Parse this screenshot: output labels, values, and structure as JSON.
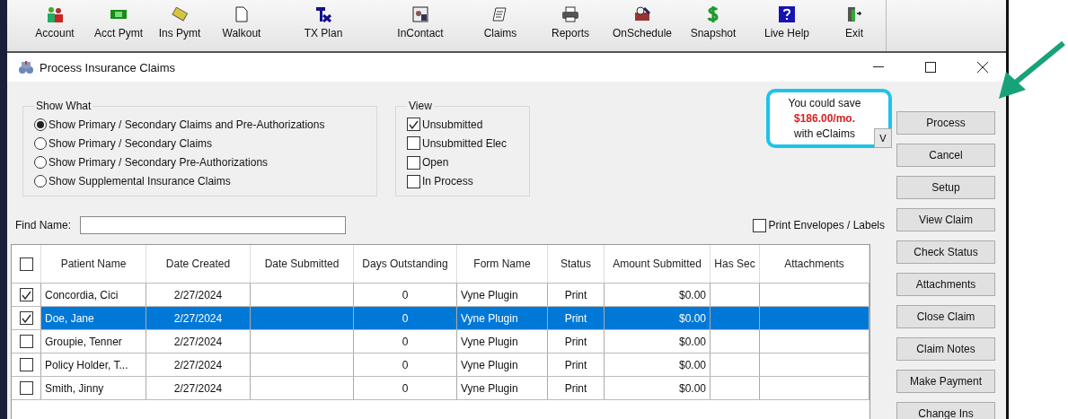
{
  "toolbar": [
    {
      "label": "Account"
    },
    {
      "label": "Acct Pymt"
    },
    {
      "label": "Ins Pymt"
    },
    {
      "label": "Walkout"
    },
    {
      "label": "TX Plan"
    },
    {
      "label": "InContact"
    },
    {
      "label": "Claims"
    },
    {
      "label": "Reports"
    },
    {
      "label": "OnSchedule"
    },
    {
      "label": "Snapshot"
    },
    {
      "label": "Live Help"
    },
    {
      "label": "Exit"
    }
  ],
  "window": {
    "title": "Process Insurance Claims"
  },
  "show_what": {
    "title": "Show What",
    "options": [
      {
        "label": "Show Primary / Secondary Claims and Pre-Authorizations",
        "selected": true
      },
      {
        "label": "Show Primary / Secondary Claims",
        "selected": false
      },
      {
        "label": "Show Primary / Secondary Pre-Authorizations",
        "selected": false
      },
      {
        "label": "Show Supplemental Insurance Claims",
        "selected": false
      }
    ]
  },
  "view": {
    "title": "View",
    "options": [
      {
        "label": "Unsubmitted",
        "checked": true
      },
      {
        "label": "Unsubmitted Elec",
        "checked": false
      },
      {
        "label": "Open",
        "checked": false
      },
      {
        "label": "In Process",
        "checked": false
      }
    ]
  },
  "promo": {
    "line_1": "You could save",
    "amount": "$186.00/mo.",
    "line_3": "with eClaims",
    "toggle": "V"
  },
  "find_name": {
    "label": "Find Name:"
  },
  "print_envelopes": {
    "label": "Print Envelopes / Labels",
    "checked": false
  },
  "table": {
    "header_checked": false,
    "columns": [
      "Patient Name",
      "Date Created",
      "Date Submitted",
      "Days Outstanding",
      "Form Name",
      "Status",
      "Amount Submitted",
      "Has Sec",
      "Attachments"
    ],
    "rows": [
      {
        "checked": true,
        "selected": false,
        "cells": [
          "Concordia, Cici",
          "2/27/2024",
          "",
          "0",
          "Vyne Plugin",
          "Print",
          "$0.00",
          "",
          ""
        ]
      },
      {
        "checked": true,
        "selected": true,
        "cells": [
          "Doe, Jane",
          "2/27/2024",
          "",
          "0",
          "Vyne Plugin",
          "Print",
          "$0.00",
          "",
          ""
        ]
      },
      {
        "checked": false,
        "selected": false,
        "cells": [
          "Groupie, Tenner",
          "2/27/2024",
          "",
          "0",
          "Vyne Plugin",
          "Print",
          "$0.00",
          "",
          ""
        ]
      },
      {
        "checked": false,
        "selected": false,
        "cells": [
          "Policy Holder, T...",
          "2/27/2024",
          "",
          "0",
          "Vyne Plugin",
          "Print",
          "$0.00",
          "",
          ""
        ]
      },
      {
        "checked": false,
        "selected": false,
        "cells": [
          "Smith, Jinny",
          "2/27/2024",
          "",
          "0",
          "Vyne Plugin",
          "Print",
          "$0.00",
          "",
          ""
        ]
      }
    ]
  },
  "buttons": [
    "Process",
    "Cancel",
    "Setup",
    "View Claim",
    "Check Status",
    "Attachments",
    "Close Claim",
    "Claim Notes",
    "Make Payment",
    "Change Ins"
  ]
}
